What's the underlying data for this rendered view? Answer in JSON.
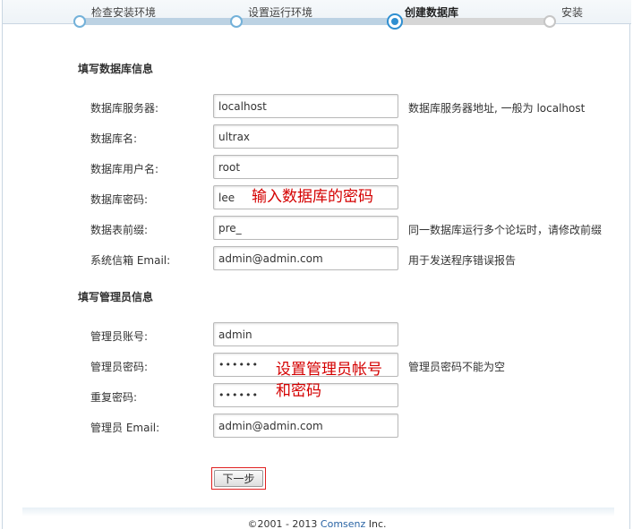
{
  "steps": [
    {
      "label": "检查安装环境",
      "state": "done"
    },
    {
      "label": "设置运行环境",
      "state": "done"
    },
    {
      "label": "创建数据库",
      "state": "current"
    },
    {
      "label": "安装",
      "state": "todo"
    }
  ],
  "db_section": {
    "title": "填写数据库信息",
    "rows": [
      {
        "label": "数据库服务器:",
        "value": "localhost",
        "hint": "数据库服务器地址, 一般为 localhost"
      },
      {
        "label": "数据库名:",
        "value": "ultrax",
        "hint": ""
      },
      {
        "label": "数据库用户名:",
        "value": "root",
        "hint": ""
      },
      {
        "label": "数据库密码:",
        "value": "lee",
        "hint": ""
      },
      {
        "label": "数据表前缀:",
        "value": "pre_",
        "hint": "同一数据库运行多个论坛时，请修改前缀"
      },
      {
        "label": "系统信箱 Email:",
        "value": "admin@admin.com",
        "hint": "用于发送程序错误报告"
      }
    ]
  },
  "admin_section": {
    "title": "填写管理员信息",
    "rows": [
      {
        "label": "管理员账号:",
        "value": "admin",
        "hint": ""
      },
      {
        "label": "管理员密码:",
        "value": "••••••",
        "hint": "管理员密码不能为空"
      },
      {
        "label": "重复密码:",
        "value": "••••••",
        "hint": ""
      },
      {
        "label": "管理员 Email:",
        "value": "admin@admin.com",
        "hint": ""
      }
    ]
  },
  "annotations": {
    "db_password": "输入数据库的密码",
    "admin_line1": "设置管理员帐号",
    "admin_line2": "和密码"
  },
  "next_button": "下一步",
  "footer": {
    "prefix": "©2001 - 2013 ",
    "brand": "Comsenz",
    "suffix": " Inc."
  },
  "colors": {
    "accent": "#2f8fd1",
    "annotation": "#d40000",
    "link": "#2a64a4"
  }
}
